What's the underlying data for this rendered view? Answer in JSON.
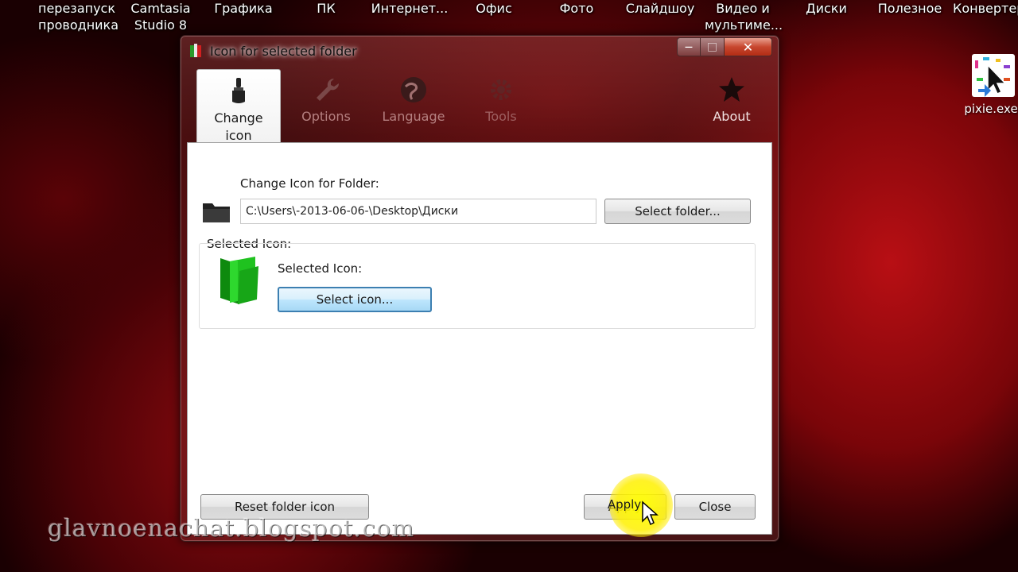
{
  "desktop": {
    "icons": [
      {
        "label_line1": "перезапуск",
        "label_line2": "проводника"
      },
      {
        "label_line1": "Camtasia",
        "label_line2": "Studio 8"
      },
      {
        "label_line1": "Графика",
        "label_line2": ""
      },
      {
        "label_line1": "ПК",
        "label_line2": ""
      },
      {
        "label_line1": "Интернет...",
        "label_line2": ""
      },
      {
        "label_line1": "Офис",
        "label_line2": ""
      },
      {
        "label_line1": "Фото",
        "label_line2": ""
      },
      {
        "label_line1": "Слайдшоу",
        "label_line2": ""
      },
      {
        "label_line1": "Видео и",
        "label_line2": "мультиме..."
      },
      {
        "label_line1": "Диски",
        "label_line2": ""
      },
      {
        "label_line1": "Полезное",
        "label_line2": ""
      },
      {
        "label_line1": "Конвертер",
        "label_line2": ""
      }
    ],
    "pixie": {
      "label": "pixie.exe",
      "icon": "pixie-cursor-icon"
    },
    "watermark": "glavnoenachat.blogspot.com"
  },
  "window": {
    "title": "Icon for selected folder",
    "buttons": {
      "minimize": "—",
      "maximize": "□",
      "close": "✕"
    },
    "tabs": [
      {
        "label_line1": "Change",
        "label_line2": "icon",
        "icon": "brush-icon",
        "active": true
      },
      {
        "label_line1": "Options",
        "label_line2": "",
        "icon": "wrench-icon",
        "active": false
      },
      {
        "label_line1": "Language",
        "label_line2": "",
        "icon": "globe-icon",
        "active": false
      },
      {
        "label_line1": "Tools",
        "label_line2": "",
        "icon": "gear-icon",
        "active": false
      },
      {
        "label_line1": "About",
        "label_line2": "",
        "icon": "star-icon",
        "active": false
      }
    ]
  },
  "change_icon": {
    "folder_label": "Change Icon for Folder:",
    "folder_path": "C:\\Users\\-2013-06-06-\\Desktop\\Диски",
    "select_folder_button": "Select folder...",
    "selected_icon_group": "Selected Icon:",
    "selected_icon_label": "Selected Icon:",
    "select_icon_button": "Select icon...",
    "reset_button": "Reset folder icon",
    "apply_button": "Apply",
    "close_button": "Close"
  },
  "colors": {
    "accent_focus": "#3c7fb1",
    "close_red": "#c7472f",
    "folder_green": "#1fc21f",
    "highlight_yellow": "#ffee00"
  }
}
